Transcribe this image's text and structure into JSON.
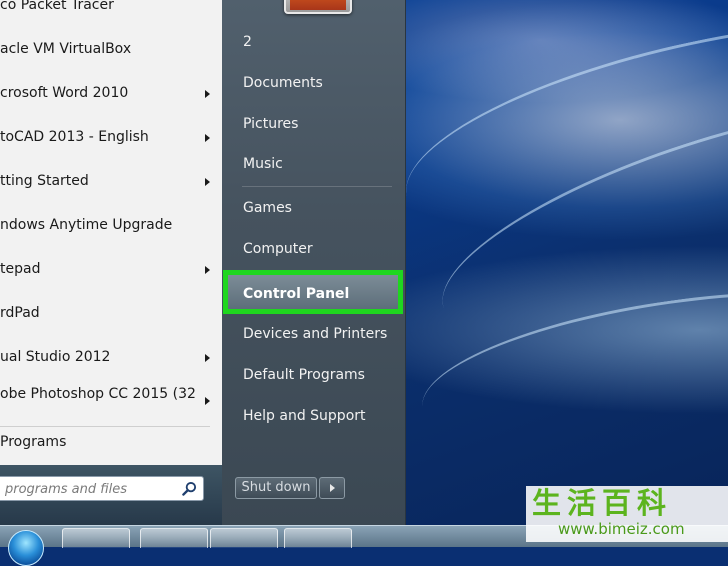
{
  "start_menu": {
    "programs": [
      {
        "label": "co Packet Tracer",
        "has_submenu": false
      },
      {
        "label": "acle VM VirtualBox",
        "has_submenu": false
      },
      {
        "label": "crosoft Word 2010",
        "has_submenu": true
      },
      {
        "label": "toCAD 2013 - English",
        "has_submenu": true
      },
      {
        "label": "tting Started",
        "has_submenu": true
      },
      {
        "label": "ndows Anytime Upgrade",
        "has_submenu": false
      },
      {
        "label": "tepad",
        "has_submenu": true
      },
      {
        "label": "rdPad",
        "has_submenu": false
      },
      {
        "label": "ual Studio 2012",
        "has_submenu": true
      },
      {
        "label": "obe Photoshop CC 2015 (32",
        "has_submenu": true
      }
    ],
    "all_programs_label": "Programs",
    "search_placeholder": "programs and files",
    "right_panel": {
      "items": [
        {
          "label": "2"
        },
        {
          "label": "Documents"
        },
        {
          "label": "Pictures"
        },
        {
          "label": "Music"
        },
        {
          "label": "Games"
        },
        {
          "label": "Computer"
        },
        {
          "label": "Control Panel",
          "highlighted": true
        },
        {
          "label": "Devices and Printers"
        },
        {
          "label": "Default Programs"
        },
        {
          "label": "Help and Support"
        }
      ],
      "shutdown_label": "Shut down"
    }
  },
  "highlight_color": "#1fd61f",
  "watermark": {
    "text_cn": "生活百科",
    "url": "www.bimeiz.com"
  }
}
